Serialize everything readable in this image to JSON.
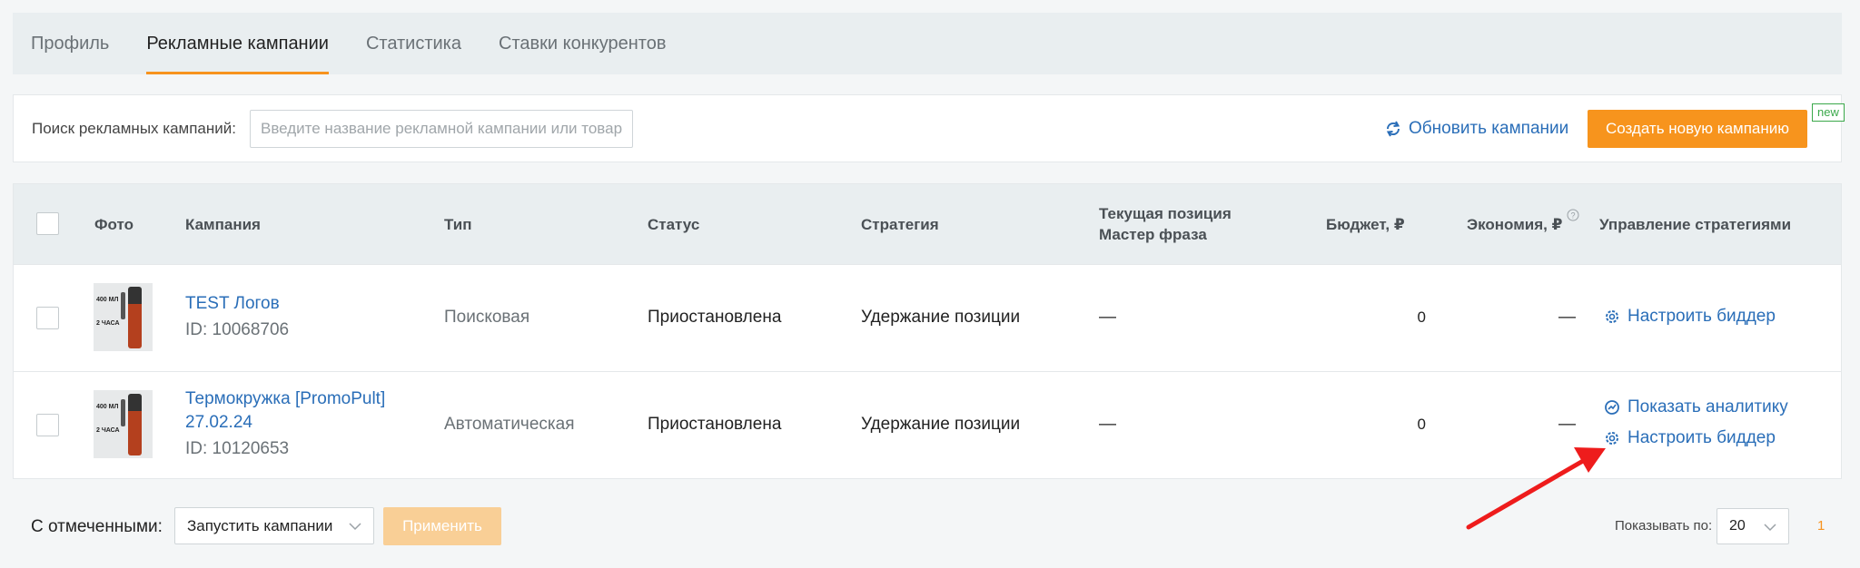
{
  "tabs": [
    {
      "label": "Профиль"
    },
    {
      "label": "Рекламные кампании"
    },
    {
      "label": "Статистика"
    },
    {
      "label": "Ставки конкурентов"
    }
  ],
  "search": {
    "label": "Поиск рекламных кампаний:",
    "placeholder": "Введите название рекламной кампании или товар",
    "refresh_label": "Обновить кампании",
    "create_label": "Создать новую кампанию",
    "new_badge": "new"
  },
  "table": {
    "headers": {
      "photo": "Фото",
      "campaign": "Кампания",
      "type": "Тип",
      "status": "Статус",
      "strategy": "Стратегия",
      "position_line1": "Текущая позиция",
      "position_line2": "Мастер фраза",
      "budget": "Бюджет, ₽",
      "savings": "Экономия, ₽",
      "manage": "Управление стратегиями"
    },
    "rows": [
      {
        "name": "TEST Логов",
        "id": "ID: 10068706",
        "type": "Поисковая",
        "status": "Приостановлена",
        "strategy": "Удержание позиции",
        "position": "—",
        "budget": "0",
        "savings": "—",
        "photo_text1": "400 МЛ",
        "photo_text2": "2 ЧАСА",
        "actions": [
          "Настроить биддер"
        ]
      },
      {
        "name": "Термокружка [PromoPult] 27.02.24",
        "id": "ID: 10120653",
        "type": "Автоматическая",
        "status": "Приостановлена",
        "strategy": "Удержание позиции",
        "position": "—",
        "budget": "0",
        "savings": "—",
        "photo_text1": "400 МЛ",
        "photo_text2": "2 ЧАСА",
        "actions": [
          "Показать аналитику",
          "Настроить биддер"
        ]
      }
    ]
  },
  "footer": {
    "selected_label": "С отмеченными:",
    "bulk_action": "Запустить кампании",
    "apply_label": "Применить",
    "per_page_label": "Показывать по:",
    "per_page_value": "20",
    "current_page": "1"
  },
  "colors": {
    "accent": "#f7941d",
    "link": "#2a6eb8",
    "annotation_arrow": "#ee1c1c"
  }
}
